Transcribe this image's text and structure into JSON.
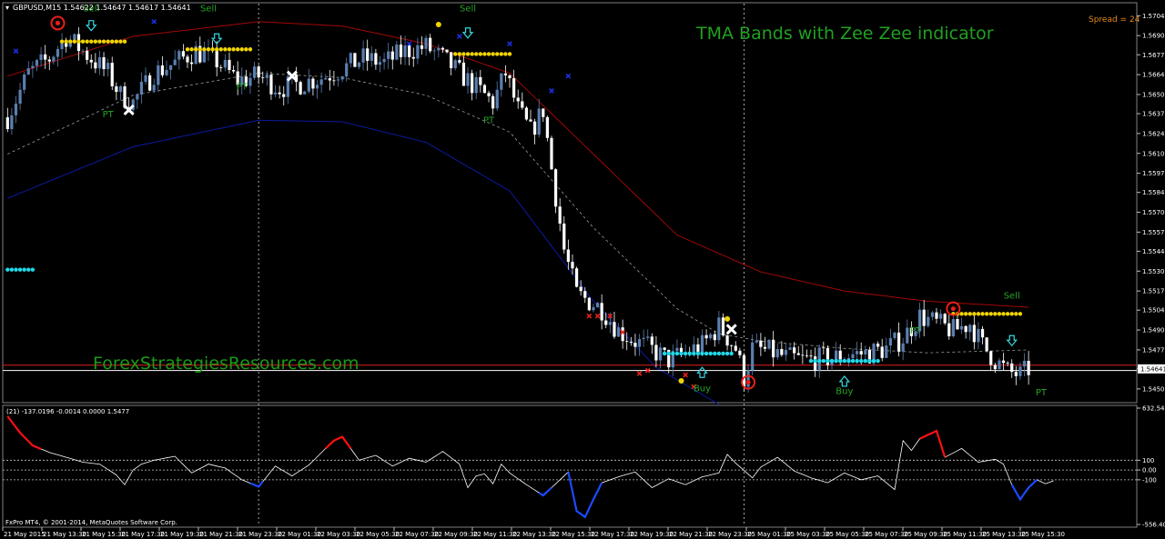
{
  "chart_data": {
    "type": "candlestick",
    "header": {
      "symbol_text": "GBPUSD,M15  1.54622 1.54647 1.54617 1.54641",
      "title": "TMA Bands with Zee Zee indicator",
      "spread_text": "Spread = 24",
      "watermark": "ForexStrategiesResources.com",
      "copyright": "FxPro MT4, © 2001-2014, MetaQuotes Software Corp."
    },
    "price_axis": {
      "ticks": [
        "1.57040",
        "1.56905",
        "1.56775",
        "1.56640",
        "1.56505",
        "1.56375",
        "1.56240",
        "1.56105",
        "1.55970",
        "1.55840",
        "1.55705",
        "1.55570",
        "1.55440",
        "1.55305",
        "1.55170",
        "1.55040",
        "1.54905",
        "1.54770",
        "1.54641",
        "1.54505"
      ],
      "current_price": "1.54641",
      "ylim": [
        1.5443,
        1.5711
      ]
    },
    "time_axis": {
      "labels": [
        "21 May 2015",
        "21 May 13:30",
        "21 May 15:30",
        "21 May 17:30",
        "21 May 19:30",
        "21 May 21:30",
        "21 May 23:30",
        "22 May 01:30",
        "22 May 03:30",
        "22 May 05:30",
        "22 May 07:30",
        "22 May 09:30",
        "22 May 11:30",
        "22 May 13:30",
        "22 May 15:30",
        "22 May 17:30",
        "22 May 19:30",
        "22 May 21:30",
        "22 May 23:30",
        "25 May 01:30",
        "25 May 03:30",
        "25 May 05:30",
        "25 May 07:30",
        "25 May 09:30",
        "25 May 11:30",
        "25 May 13:30",
        "25 May 15:30"
      ]
    },
    "close_anchors": [
      [
        0,
        1.5635
      ],
      [
        5,
        1.5665
      ],
      [
        10,
        1.5675
      ],
      [
        14,
        1.569
      ],
      [
        18,
        1.568
      ],
      [
        24,
        1.5665
      ],
      [
        27,
        1.565
      ],
      [
        30,
        1.5645
      ],
      [
        35,
        1.5665
      ],
      [
        40,
        1.5672
      ],
      [
        45,
        1.568
      ],
      [
        50,
        1.5673
      ],
      [
        55,
        1.566
      ],
      [
        60,
        1.5663
      ],
      [
        65,
        1.5655
      ],
      [
        70,
        1.5658
      ],
      [
        75,
        1.5662
      ],
      [
        80,
        1.5668
      ],
      [
        85,
        1.5675
      ],
      [
        90,
        1.5672
      ],
      [
        95,
        1.568
      ],
      [
        100,
        1.5683
      ],
      [
        104,
        1.5675
      ],
      [
        108,
        1.5665
      ],
      [
        112,
        1.5655
      ],
      [
        116,
        1.5645
      ],
      [
        119,
        1.5665
      ],
      [
        122,
        1.564
      ],
      [
        125,
        1.5625
      ],
      [
        128,
        1.564
      ],
      [
        130,
        1.56
      ],
      [
        133,
        1.5545
      ],
      [
        136,
        1.5515
      ],
      [
        139,
        1.551
      ],
      [
        142,
        1.5505
      ],
      [
        146,
        1.549
      ],
      [
        150,
        1.5483
      ],
      [
        154,
        1.5477
      ],
      [
        158,
        1.547
      ],
      [
        162,
        1.5475
      ],
      [
        166,
        1.548
      ],
      [
        170,
        1.5493
      ],
      [
        174,
        1.5478
      ],
      [
        176,
        1.5458
      ],
      [
        178,
        1.5478
      ],
      [
        182,
        1.5476
      ],
      [
        186,
        1.5472
      ],
      [
        190,
        1.547
      ],
      [
        194,
        1.5471
      ],
      [
        198,
        1.5472
      ],
      [
        202,
        1.5474
      ],
      [
        206,
        1.5475
      ],
      [
        210,
        1.5478
      ],
      [
        214,
        1.5485
      ],
      [
        218,
        1.55
      ],
      [
        222,
        1.5495
      ],
      [
        226,
        1.549
      ],
      [
        230,
        1.5495
      ],
      [
        233,
        1.548
      ],
      [
        236,
        1.547
      ],
      [
        239,
        1.5462
      ],
      [
        242,
        1.546
      ],
      [
        244,
        1.5464
      ]
    ],
    "bands": {
      "upper_red": [
        [
          0,
          1.5663
        ],
        [
          30,
          1.569
        ],
        [
          60,
          1.57
        ],
        [
          80,
          1.5697
        ],
        [
          100,
          1.5685
        ],
        [
          120,
          1.5665
        ],
        [
          140,
          1.561
        ],
        [
          160,
          1.5555
        ],
        [
          180,
          1.553
        ],
        [
          200,
          1.5517
        ],
        [
          220,
          1.551
        ],
        [
          244,
          1.5506
        ]
      ],
      "middle_dashed": [
        [
          0,
          1.561
        ],
        [
          30,
          1.565
        ],
        [
          60,
          1.5665
        ],
        [
          80,
          1.5662
        ],
        [
          100,
          1.565
        ],
        [
          120,
          1.5625
        ],
        [
          140,
          1.556
        ],
        [
          160,
          1.5505
        ],
        [
          170,
          1.5488
        ],
        [
          180,
          1.5483
        ],
        [
          200,
          1.5478
        ],
        [
          220,
          1.5475
        ],
        [
          244,
          1.5477
        ]
      ],
      "lower_blue": [
        [
          0,
          1.558
        ],
        [
          30,
          1.5615
        ],
        [
          60,
          1.5633
        ],
        [
          80,
          1.5632
        ],
        [
          100,
          1.5618
        ],
        [
          120,
          1.5585
        ],
        [
          140,
          1.551
        ],
        [
          155,
          1.5465
        ],
        [
          170,
          1.544
        ]
      ]
    },
    "hlines": [
      {
        "price": 1.54666,
        "color": "#e0201e"
      },
      {
        "price": 1.5463,
        "color": "#ffffff"
      }
    ],
    "vlines": [
      60,
      176
    ],
    "signal_labels": [
      {
        "text": "Sell",
        "bar": 20,
        "price": 1.5707
      },
      {
        "text": "Sell",
        "bar": 48,
        "price": 1.5707
      },
      {
        "text": "Sell",
        "bar": 110,
        "price": 1.5707
      },
      {
        "text": "PT",
        "bar": 24,
        "price": 1.5635
      },
      {
        "text": "PT",
        "bar": 56,
        "price": 1.5654
      },
      {
        "text": "PT",
        "bar": 115,
        "price": 1.5631
      },
      {
        "text": "Buy",
        "bar": 166,
        "price": 1.5449
      },
      {
        "text": "Buy",
        "bar": 200,
        "price": 1.5447
      },
      {
        "text": "Sell",
        "bar": 240,
        "price": 1.5512
      },
      {
        "text": "PT",
        "bar": 217,
        "price": 1.5488
      },
      {
        "text": "PT",
        "bar": 247,
        "price": 1.5446
      }
    ],
    "arrows_down": [
      [
        20,
        1.5697
      ],
      [
        50,
        1.5688
      ],
      [
        110,
        1.5692
      ],
      [
        240,
        1.5483
      ]
    ],
    "arrows_up": [
      [
        166,
        1.5462
      ],
      [
        200,
        1.5456
      ]
    ],
    "dot_rows": [
      {
        "color": "#f2d400",
        "bar_from": 13,
        "bar_to": 28,
        "price": 1.56865
      },
      {
        "color": "#f2d400",
        "bar_from": 43,
        "bar_to": 58,
        "price": 1.56812
      },
      {
        "color": "#f2d400",
        "bar_from": 107,
        "bar_to": 120,
        "price": 1.5678
      },
      {
        "color": "#20d8e8",
        "bar_from": 0,
        "bar_to": 6,
        "price": 1.55315
      },
      {
        "color": "#20d8e8",
        "bar_from": 157,
        "bar_to": 173,
        "price": 1.54745
      },
      {
        "color": "#20d8e8",
        "bar_from": 192,
        "bar_to": 208,
        "price": 1.54695
      },
      {
        "color": "#f2d400",
        "bar_from": 226,
        "bar_to": 242,
        "price": 1.55015
      }
    ],
    "circles": [
      [
        12,
        1.5699
      ],
      [
        177,
        1.5455
      ],
      [
        226,
        1.5505
      ]
    ],
    "x_white": [
      [
        29,
        1.564
      ],
      [
        68,
        1.5663
      ],
      [
        173,
        1.5491
      ]
    ],
    "x_blue": [
      [
        2,
        1.568
      ],
      [
        35,
        1.57
      ],
      [
        96,
        1.5685
      ],
      [
        108,
        1.569
      ],
      [
        120,
        1.5685
      ],
      [
        130,
        1.5653
      ],
      [
        134,
        1.5663
      ]
    ],
    "x_red": [
      [
        139,
        1.55
      ],
      [
        141,
        1.55
      ],
      [
        144,
        1.55
      ],
      [
        147,
        1.5489
      ],
      [
        151,
        1.5461
      ],
      [
        153,
        1.5463
      ],
      [
        162,
        1.546
      ],
      [
        164,
        1.5452
      ]
    ],
    "yellow_dots": [
      [
        103,
        1.5698
      ],
      [
        172,
        1.5498
      ],
      [
        161,
        1.5456
      ]
    ],
    "oscillator": {
      "header_text": "(21) -137.0196 -0.0014 0.0000 1.5477",
      "ticks": [
        "632.5494",
        "100",
        "0.00",
        "-100",
        "-556.4067"
      ],
      "ylim": [
        -556.4067,
        632.5494
      ],
      "levels": [
        100,
        0,
        -100
      ],
      "anchors": [
        [
          0,
          550
        ],
        [
          3,
          380
        ],
        [
          6,
          250
        ],
        [
          10,
          180
        ],
        [
          14,
          130
        ],
        [
          18,
          80
        ],
        [
          22,
          60
        ],
        [
          26,
          -50
        ],
        [
          28,
          -150
        ],
        [
          30,
          0
        ],
        [
          32,
          60
        ],
        [
          35,
          100
        ],
        [
          40,
          140
        ],
        [
          44,
          -30
        ],
        [
          48,
          60
        ],
        [
          52,
          20
        ],
        [
          56,
          -100
        ],
        [
          60,
          -170
        ],
        [
          64,
          40
        ],
        [
          68,
          -60
        ],
        [
          72,
          50
        ],
        [
          76,
          220
        ],
        [
          78,
          300
        ],
        [
          80,
          340
        ],
        [
          82,
          220
        ],
        [
          84,
          100
        ],
        [
          88,
          150
        ],
        [
          92,
          40
        ],
        [
          96,
          120
        ],
        [
          100,
          80
        ],
        [
          104,
          190
        ],
        [
          108,
          60
        ],
        [
          110,
          -180
        ],
        [
          112,
          -60
        ],
        [
          114,
          -40
        ],
        [
          116,
          -140
        ],
        [
          118,
          60
        ],
        [
          120,
          -30
        ],
        [
          124,
          -150
        ],
        [
          128,
          -260
        ],
        [
          132,
          -100
        ],
        [
          134,
          -20
        ],
        [
          136,
          -420
        ],
        [
          138,
          -480
        ],
        [
          140,
          -300
        ],
        [
          142,
          -130
        ],
        [
          146,
          -70
        ],
        [
          150,
          -20
        ],
        [
          154,
          -180
        ],
        [
          158,
          -90
        ],
        [
          162,
          -150
        ],
        [
          166,
          -70
        ],
        [
          170,
          -30
        ],
        [
          172,
          160
        ],
        [
          174,
          70
        ],
        [
          178,
          -80
        ],
        [
          180,
          30
        ],
        [
          184,
          130
        ],
        [
          188,
          -10
        ],
        [
          192,
          -80
        ],
        [
          196,
          -130
        ],
        [
          200,
          -30
        ],
        [
          204,
          -100
        ],
        [
          208,
          -60
        ],
        [
          212,
          -200
        ],
        [
          214,
          300
        ],
        [
          216,
          200
        ],
        [
          218,
          320
        ],
        [
          222,
          400
        ],
        [
          224,
          130
        ],
        [
          228,
          220
        ],
        [
          232,
          80
        ],
        [
          236,
          110
        ],
        [
          238,
          60
        ],
        [
          240,
          -150
        ],
        [
          242,
          -300
        ],
        [
          244,
          -180
        ],
        [
          246,
          -100
        ],
        [
          248,
          -140
        ],
        [
          250,
          -110
        ]
      ],
      "red_segments": [
        [
          0,
          8
        ],
        [
          76,
          82
        ],
        [
          218,
          224
        ]
      ],
      "blue_segments": [
        [
          58,
          61
        ],
        [
          127,
          130
        ],
        [
          134,
          142
        ],
        [
          240,
          246
        ]
      ]
    },
    "colors": {
      "bull": "#5a7fb0",
      "bear": "#ffffff",
      "upper_band": "#a00808",
      "middle_band": "#9a9a9a",
      "lower_band": "#0c1aa0",
      "signal_text": "#26a526",
      "arrow": "#35d7df",
      "circle": "#e8201a",
      "osc_line": "#ffffff",
      "osc_red": "#ff1010",
      "osc_blue": "#1a4bff"
    }
  }
}
